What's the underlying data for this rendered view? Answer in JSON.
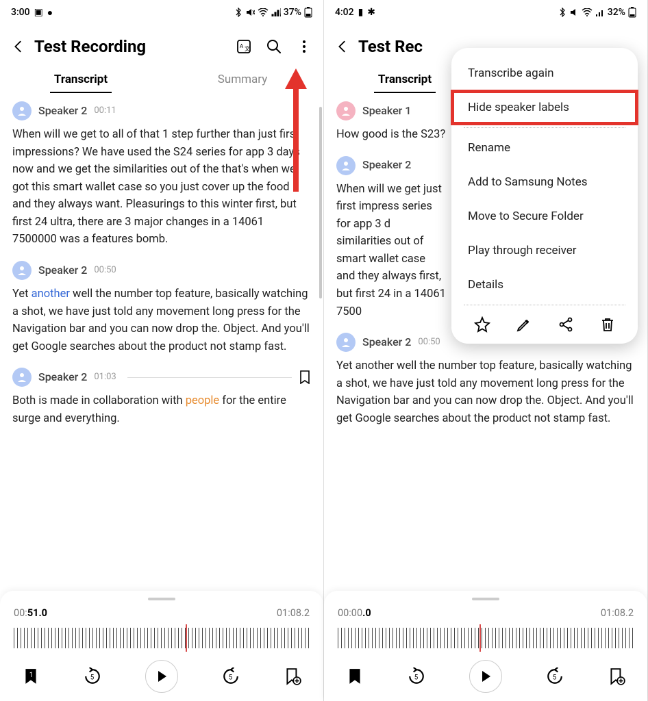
{
  "left": {
    "status": {
      "time": "3:00",
      "battery": "37%"
    },
    "title": "Test Recording",
    "tabs": {
      "transcript": "Transcript",
      "summary": "Summary"
    },
    "entries": [
      {
        "speaker": "Speaker 2",
        "time": "00:11",
        "avatar": "blue",
        "text_pre": "When will we get to all of that 1 step further than just first impressions? We have used the S24 series for app 3 days now and we get the similarities out of the that's when we got this smart wallet case so you just cover up the food and they always want. Pleasurings to this winter first, but first 24 ultra, there are 3 major changes in a 14061 7500000 was a features bomb."
      },
      {
        "speaker": "Speaker 2",
        "time": "00:50",
        "avatar": "blue",
        "text_pre": "Yet ",
        "link_blue": "another",
        "text_post": " well the number top feature, basically watching a shot, we have just told any movement long press for the Navigation bar and you can now drop the. Object. And you'll get Google searches about the product not stamp fast."
      },
      {
        "speaker": "Speaker 2",
        "time": "01:03",
        "avatar": "blue",
        "has_divider": true,
        "text_pre": "Both is made in collaboration with ",
        "link_orange": "people",
        "text_post": " for the entire surge and everything."
      }
    ],
    "player": {
      "current_pre": "00:",
      "current_bold": "51.0",
      "total": "01:08.2",
      "bookmark_badge": "1",
      "playhead_pct": 58
    }
  },
  "right": {
    "status": {
      "time": "4:02",
      "battery": "32%"
    },
    "title": "Test Rec",
    "tabs": {
      "transcript": "Transcript",
      "summary": ""
    },
    "entries": [
      {
        "speaker": "Speaker 1",
        "time": "",
        "avatar": "pink",
        "text_pre": "How good is the S23?"
      },
      {
        "speaker": "Speaker 2",
        "time": "",
        "avatar": "blue",
        "text_pre": "When will we get just first impress series for app 3 d similarities out of smart wallet case and they always first, but first 24 in a 14061 7500"
      },
      {
        "speaker": "Speaker 2",
        "time": "00:50",
        "avatar": "blue",
        "text_pre": "Yet another well the number top feature, basically watching a shot, we have just told any movement long press for the Navigation bar and you can now drop the. Object. And you'll get Google searches about the product not stamp fast."
      }
    ],
    "menu": {
      "items": [
        "Transcribe again",
        "Hide speaker labels",
        "Rename",
        "Add to Samsung Notes",
        "Move to Secure Folder",
        "Play through receiver",
        "Details"
      ],
      "highlighted_index": 1
    },
    "player": {
      "current_pre": "00:00",
      "current_bold": ".0",
      "total": "01:08.2",
      "playhead_pct": 48
    }
  }
}
